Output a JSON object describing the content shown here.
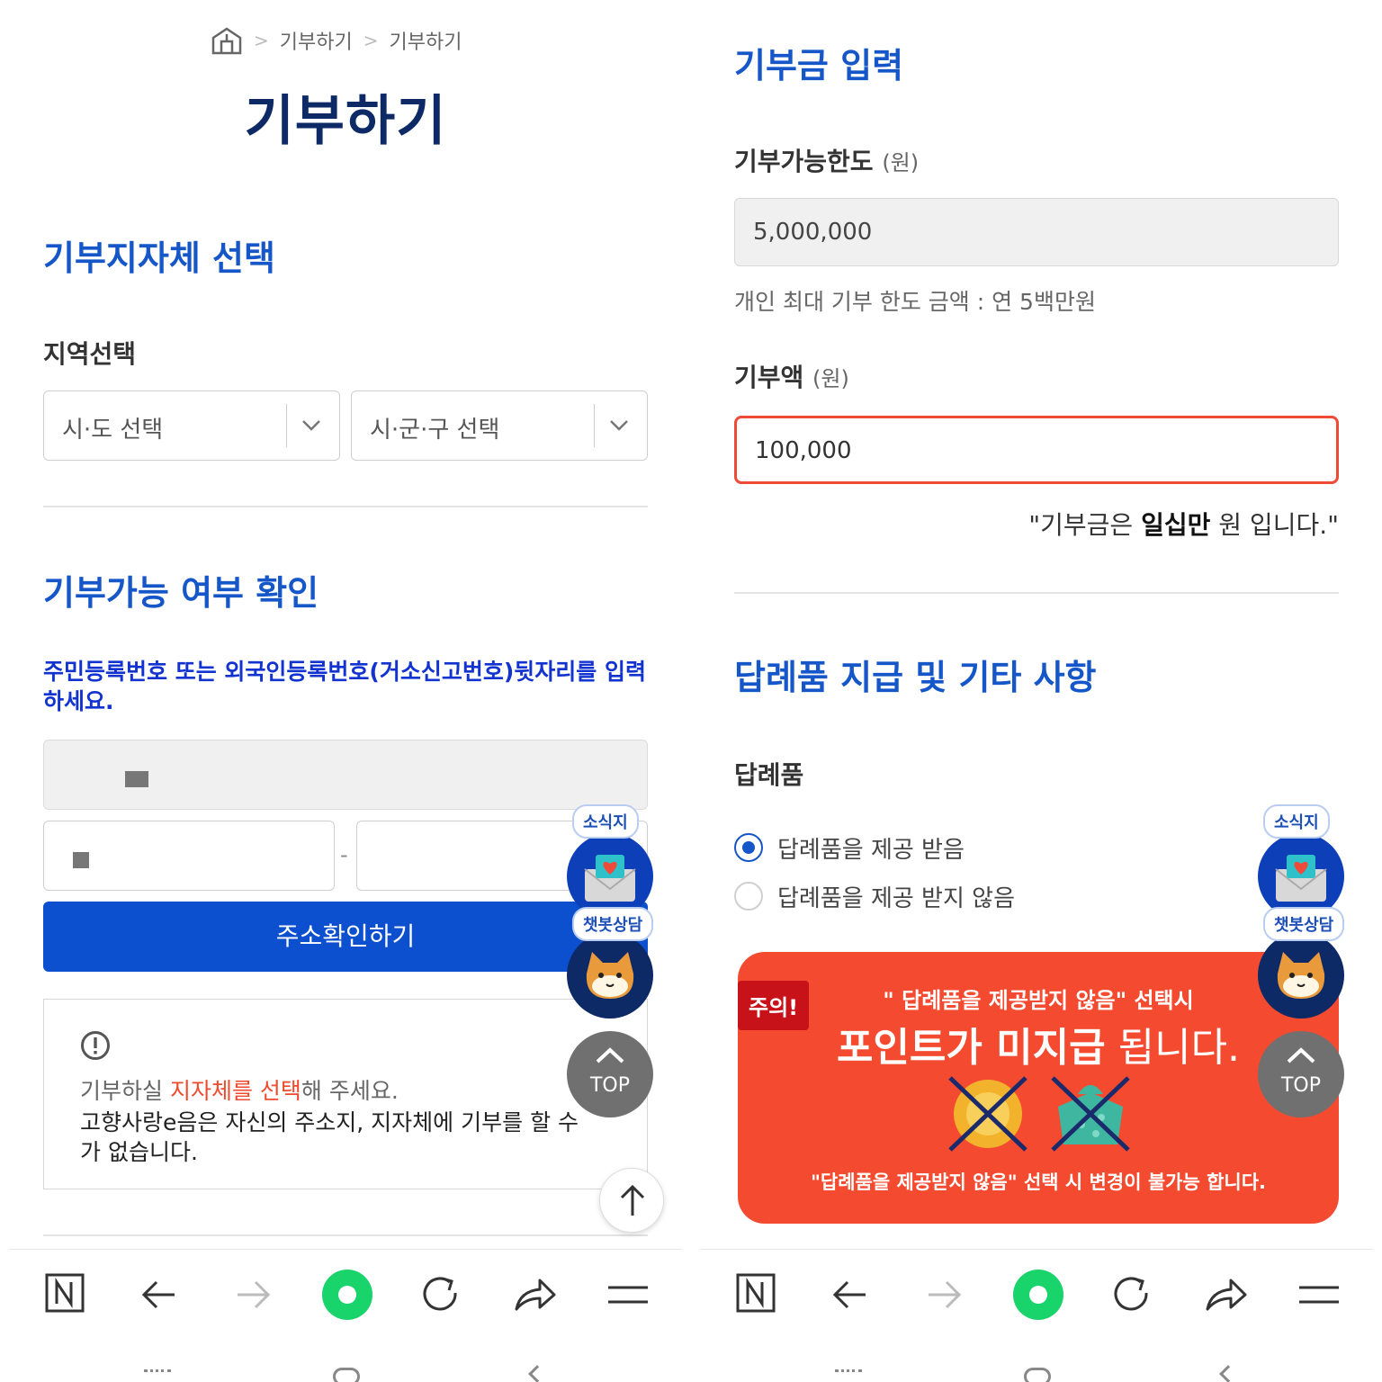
{
  "left": {
    "breadcrumb": {
      "items": [
        "기부하기",
        "기부하기"
      ]
    },
    "page_title": "기부하기",
    "region_section": {
      "title": "기부지자체 선택",
      "label": "지역선택",
      "sido_select": "시·도 선택",
      "sigungu_select": "시·군·구 선택"
    },
    "eligibility_section": {
      "title": "기부가능 여부 확인",
      "note": "주민등록번호 또는 외국인등록번호(거소신고번호)뒷자리를 입력하세요.",
      "separator": "-",
      "address_button": "주소확인하기",
      "notice_prefix": "기부하실 ",
      "notice_highlight": "지자체를 선택",
      "notice_suffix": "해 주세요.",
      "notice_body": "고향사랑e음은 자신의 주소지, 지자체에 기부를 할 수 가 없습니다."
    }
  },
  "right": {
    "amount_section": {
      "title": "기부금 입력",
      "limit_label": "기부가능한도",
      "limit_unit": "(원)",
      "limit_value": "5,000,000",
      "limit_hint": "개인 최대 기부 한도 금액 : 연 5백만원",
      "amount_label": "기부액",
      "amount_unit": "(원)",
      "amount_value": "100,000",
      "amount_quote_prefix": "\"기부금은 ",
      "amount_quote_bold": "일십만",
      "amount_quote_suffix": " 원 입니다.\""
    },
    "gift_section": {
      "title": "답례품 지급 및 기타 사항",
      "label": "답례품",
      "options": [
        "답례품을 제공 받음",
        "답례품을 제공 받지 않음"
      ],
      "selected_index": 0,
      "warning": {
        "tag": "주의!",
        "line1": "\" 답례품을 제공받지 않음\" 선택시",
        "line2_bold": "포인트가 미지급",
        "line2_rest": " 됩니다.",
        "footer": "\"답례품을 제공받지 않음\" 선택 시 변경이 불가능 합니다."
      }
    }
  },
  "floating": {
    "newsletter_tag": "소식지",
    "chatbot_tag": "챗봇상담",
    "top_label": "TOP"
  },
  "bottom_nav": {
    "icons": [
      "naver-n-icon",
      "back-arrow-icon",
      "forward-arrow-icon",
      "home-circle-icon",
      "refresh-icon",
      "share-icon",
      "menu-icon"
    ]
  },
  "colors": {
    "primary": "#0c4fcf",
    "title_blue": "#1556c9",
    "navy": "#0d2a66",
    "warning_red": "#f44b30",
    "highlight_orange": "#ef4a2d",
    "home_green": "#19d36b"
  }
}
